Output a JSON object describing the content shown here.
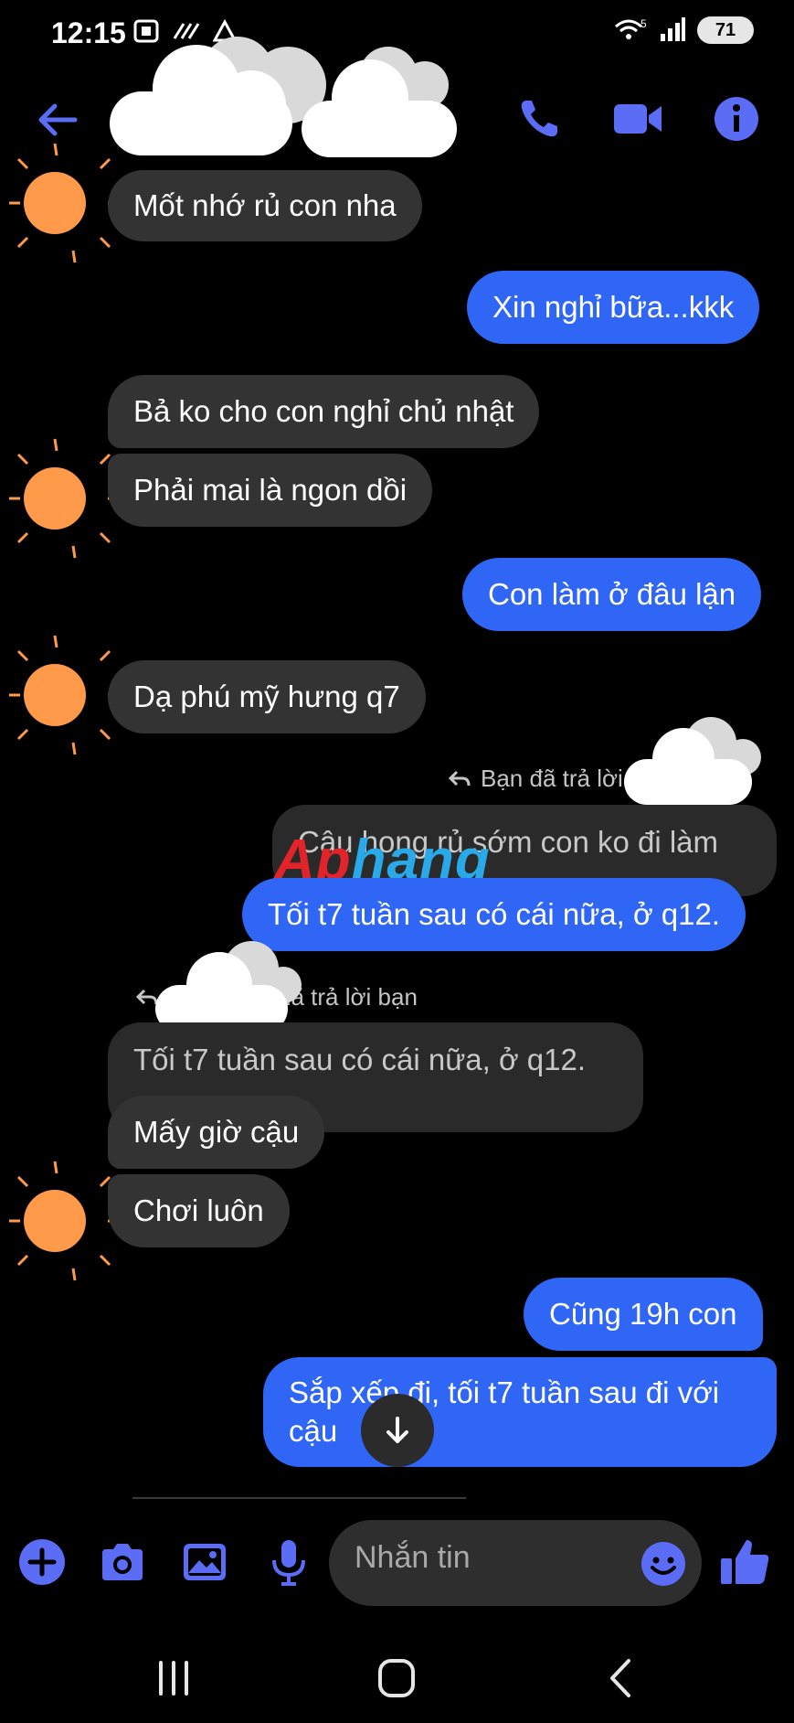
{
  "status_bar": {
    "time": "12:15",
    "battery": "71",
    "signal_sup": "5"
  },
  "header": {
    "contact_name": "",
    "contact_status": ""
  },
  "messages": {
    "m1": "Mốt nhớ rủ con nha",
    "m2": "Xin nghỉ bữa...kkk",
    "m3": "Bả ko cho con nghỉ chủ nhật",
    "m4": "Phải mai là ngon dồi",
    "m5": "Con làm ở đâu lận",
    "m6": "Dạ phú mỹ hưng q7",
    "reply1_label": "Bạn đã trả lời",
    "m7_quoted": "Cậu hong rủ sớm con ko đi làm",
    "m7": "Tối t7 tuần sau có cái nữa, ở q12.",
    "reply2_label": "đã trả lời bạn",
    "m8_quoted": "Tối t7 tuần sau có cái nữa, ở q12.",
    "m8": "Mấy giờ cậu",
    "m9": "Chơi luôn",
    "m10": "Cũng 19h con",
    "m11_line1": "Sắp xếp đi, tối t7 tuần sau đi với",
    "m11_line2": "cậu"
  },
  "watermark": {
    "part1": "Ap",
    "part2": "hang"
  },
  "composer": {
    "placeholder": "Nhắn tin"
  },
  "colors": {
    "accent": "#5b6cf5",
    "sent_bubble": "#2f66f5",
    "recv_bubble": "#333333",
    "avatar": "#ff9a4a"
  },
  "icons": [
    "back-arrow-icon",
    "phone-icon",
    "video-icon",
    "info-icon",
    "plus-icon",
    "camera-icon",
    "image-icon",
    "mic-icon",
    "emoji-icon",
    "like-icon",
    "arrow-down-icon",
    "recents-icon",
    "home-icon",
    "nav-back-icon",
    "reply-icon"
  ]
}
